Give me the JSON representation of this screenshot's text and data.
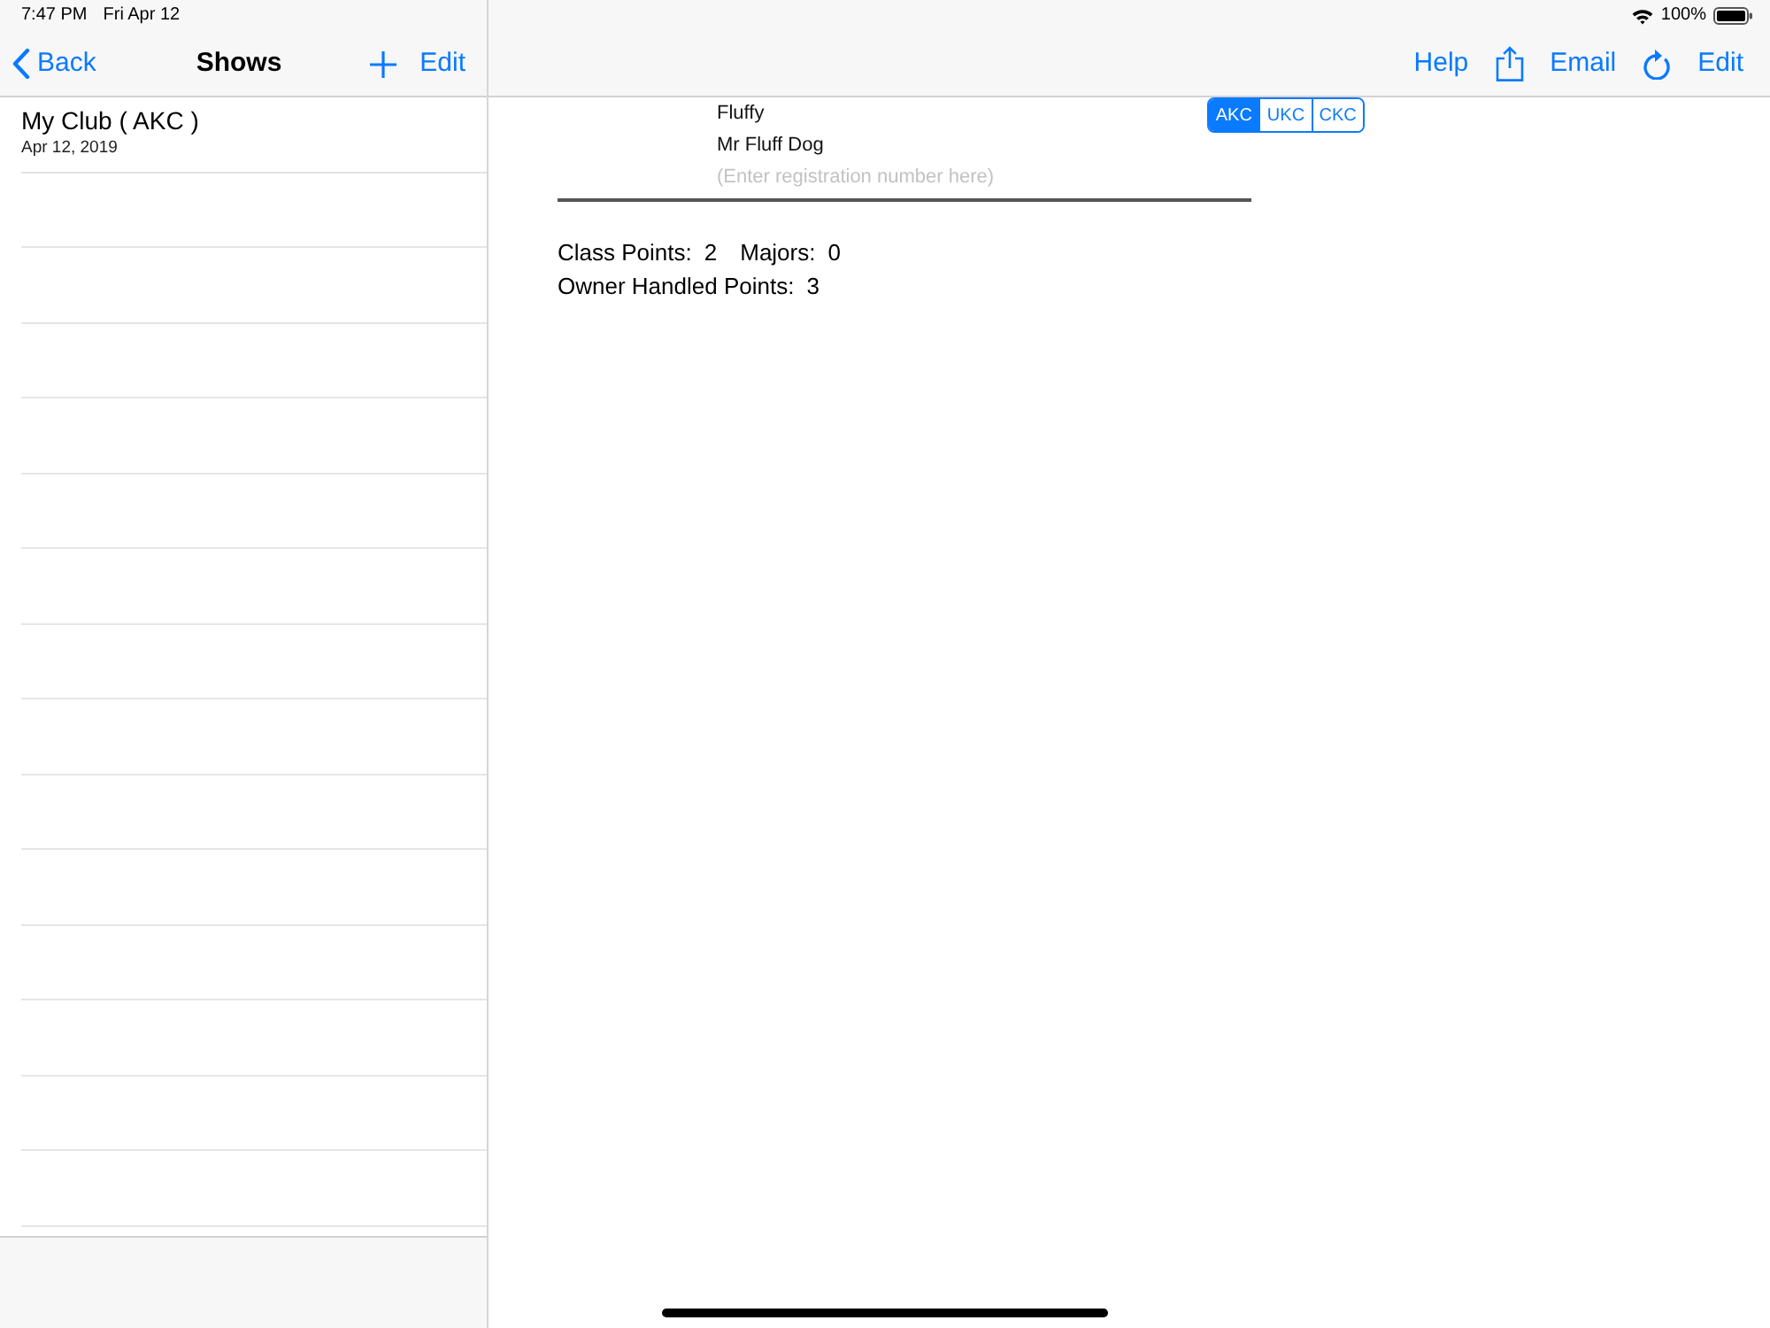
{
  "status_bar": {
    "time": "7:47 PM",
    "date": "Fri Apr 12",
    "battery": "100%"
  },
  "sidebar": {
    "back": "Back",
    "title": "Shows",
    "nav_buttons": [
      {
        "kind": "add"
      },
      {
        "kind": "text",
        "label": "Edit"
      }
    ],
    "items": [
      {
        "title": "My Club ( AKC )",
        "date": "Apr 12, 2019",
        "selected": false
      }
    ]
  },
  "detail": {
    "nav_buttons": [
      {
        "kind": "text",
        "label": "Help"
      },
      {
        "kind": "share"
      },
      {
        "kind": "text",
        "label": "Email"
      },
      {
        "kind": "refresh"
      },
      {
        "kind": "text",
        "label": "Edit"
      }
    ],
    "dog": {
      "call_name": "Fluffy",
      "registered_name": "Mr Fluff Dog",
      "registration_number": {
        "placeholder": "(Enter registration number here)"
      }
    },
    "registry": [
      {
        "label": "AKC",
        "selected": true
      },
      {
        "label": "UKC",
        "selected": false
      },
      {
        "label": "CKC",
        "selected": false
      }
    ],
    "stats": [
      [
        {
          "label": "Class Points:",
          "value": "2"
        },
        {
          "label": "Majors:",
          "value": "0"
        }
      ],
      [
        {
          "label": "Owner Handled Points:",
          "value": "3"
        }
      ]
    ]
  }
}
